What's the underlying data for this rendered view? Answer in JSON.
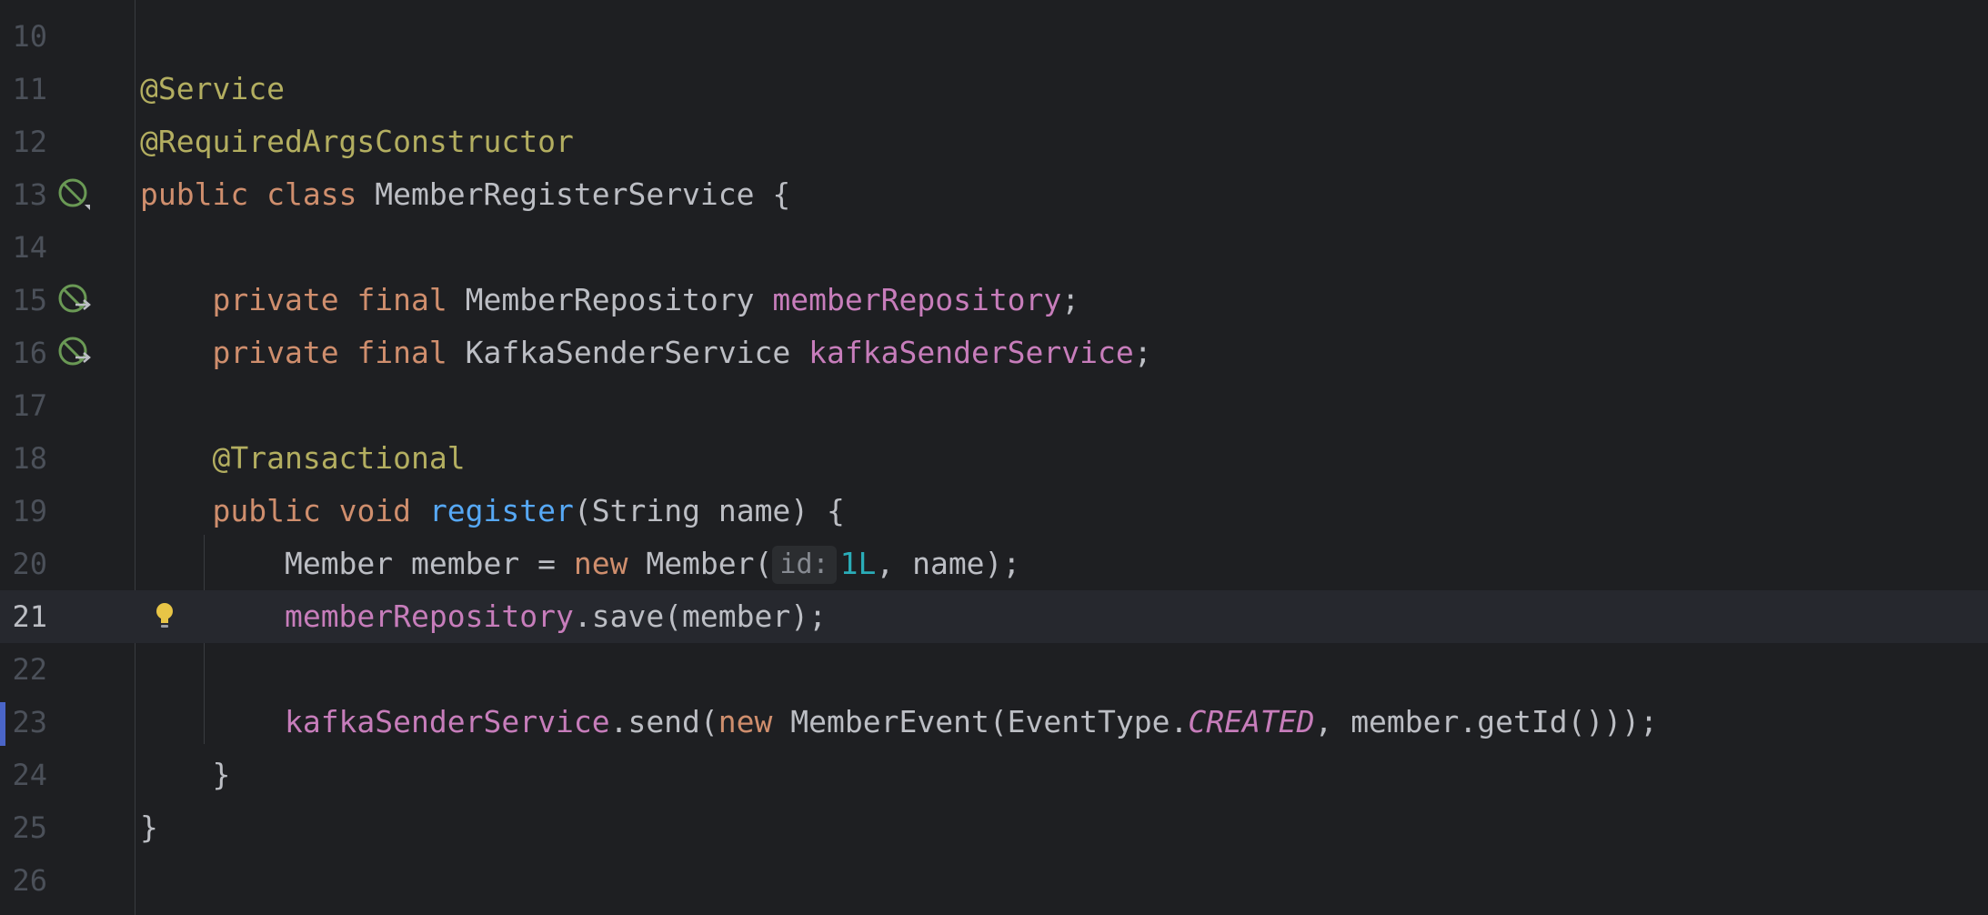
{
  "editor": {
    "current_line": "21",
    "lines": [
      {
        "num": "10"
      },
      {
        "num": "11"
      },
      {
        "num": "12"
      },
      {
        "num": "13"
      },
      {
        "num": "14"
      },
      {
        "num": "15"
      },
      {
        "num": "16"
      },
      {
        "num": "17"
      },
      {
        "num": "18"
      },
      {
        "num": "19"
      },
      {
        "num": "20"
      },
      {
        "num": "21"
      },
      {
        "num": "22"
      },
      {
        "num": "23"
      },
      {
        "num": "24"
      },
      {
        "num": "25"
      },
      {
        "num": "26"
      }
    ],
    "tokens": {
      "l11_ann": "@Service",
      "l12_ann": "@RequiredArgsConstructor",
      "l13_public": "public",
      "l13_class": "class",
      "l13_rest": " MemberRegisterService {",
      "l15_private": "private",
      "l15_final": "final",
      "l15_type": " MemberRepository ",
      "l15_field": "memberRepository",
      "l15_end": ";",
      "l16_private": "private",
      "l16_final": "final",
      "l16_type": " KafkaSenderService ",
      "l16_field": "kafkaSenderService",
      "l16_end": ";",
      "l18_ann": "@Transactional",
      "l19_public": "public",
      "l19_void": "void",
      "l19_method": "register",
      "l19_rest": "(String name) {",
      "l20_pre": "Member member = ",
      "l20_new": "new",
      "l20_ctor": " Member(",
      "l20_hint": "id:",
      "l20_num": "1L",
      "l20_rest": ", name);",
      "l21_field": "memberRepository",
      "l21_rest": ".save(member);",
      "l23_field": "kafkaSenderService",
      "l23_send": ".send(",
      "l23_new": "new",
      "l23_mid": " MemberEvent(EventType.",
      "l23_const": "CREATED",
      "l23_rest": ", member.getId()));",
      "l24_brace": "}",
      "l25_brace": "}"
    }
  },
  "colors": {
    "background": "#1e1f22",
    "keyword": "#cf8e6d",
    "annotation": "#b3ae60",
    "field": "#c77dbb",
    "method": "#56a8f5",
    "number": "#2aacb8",
    "current_line_bg": "#26282e",
    "change_marker": "#4a65c8"
  },
  "icons": {
    "class_gutter": "spring-bean-class-icon",
    "field_gutter": "spring-bean-navigate-icon",
    "intention": "lightbulb-icon"
  }
}
